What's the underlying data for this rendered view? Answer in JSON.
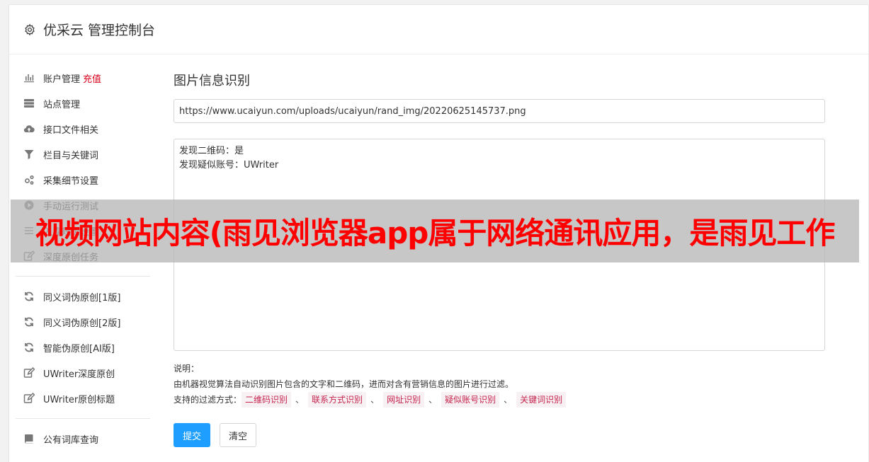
{
  "header": {
    "title": "优采云 管理控制台"
  },
  "sidebar": {
    "group1": [
      {
        "label": "账户管理",
        "badge": "充值",
        "icon": "bar-chart-icon"
      },
      {
        "label": "站点管理",
        "icon": "server-icon"
      },
      {
        "label": "接口文件相关",
        "icon": "cloud-upload-icon"
      },
      {
        "label": "栏目与关键词",
        "icon": "filter-icon"
      },
      {
        "label": "采集细节设置",
        "icon": "cogs-icon"
      },
      {
        "label": "手动运行测试",
        "icon": "play-circle-icon"
      },
      {
        "label": "入库规则设置",
        "icon": "list-icon"
      },
      {
        "label": "深度原创任务",
        "icon": "edit-icon"
      }
    ],
    "group2": [
      {
        "label": "同义词伪原创[1版]",
        "icon": "refresh-icon"
      },
      {
        "label": "同义词伪原创[2版]",
        "icon": "refresh-icon"
      },
      {
        "label": "智能伪原创[AI版]",
        "icon": "refresh-icon"
      },
      {
        "label": "UWriter深度原创",
        "icon": "edit-icon"
      },
      {
        "label": "UWriter原创标题",
        "icon": "edit-icon"
      }
    ],
    "group3": [
      {
        "label": "公有词库查询",
        "icon": "book-icon"
      }
    ]
  },
  "main": {
    "title": "图片信息识别",
    "url_value": "https://www.ucaiyun.com/uploads/ucaiyun/rand_img/20220625145737.png",
    "result_text": "发现二维码：是\n发现疑似账号：UWriter",
    "desc_label": "说明：",
    "desc_text": "由机器视觉算法自动识别图片包含的文字和二维码，进而对含有营销信息的图片进行过滤。",
    "filter_label": "支持的过滤方式：",
    "filters": [
      "二维码识别",
      "联系方式识别",
      "网址识别",
      "疑似账号识别",
      "关键词识别"
    ],
    "separator": "、",
    "submit_label": "提交",
    "clear_label": "清空"
  },
  "banner": {
    "text": "视频网站内容(雨见浏览器app属于网络通讯应用，是雨见工作"
  },
  "colors": {
    "primary": "#1e9fff",
    "badge": "#d9001b",
    "tag_text": "#c7254e",
    "banner_text": "#ff0000"
  }
}
